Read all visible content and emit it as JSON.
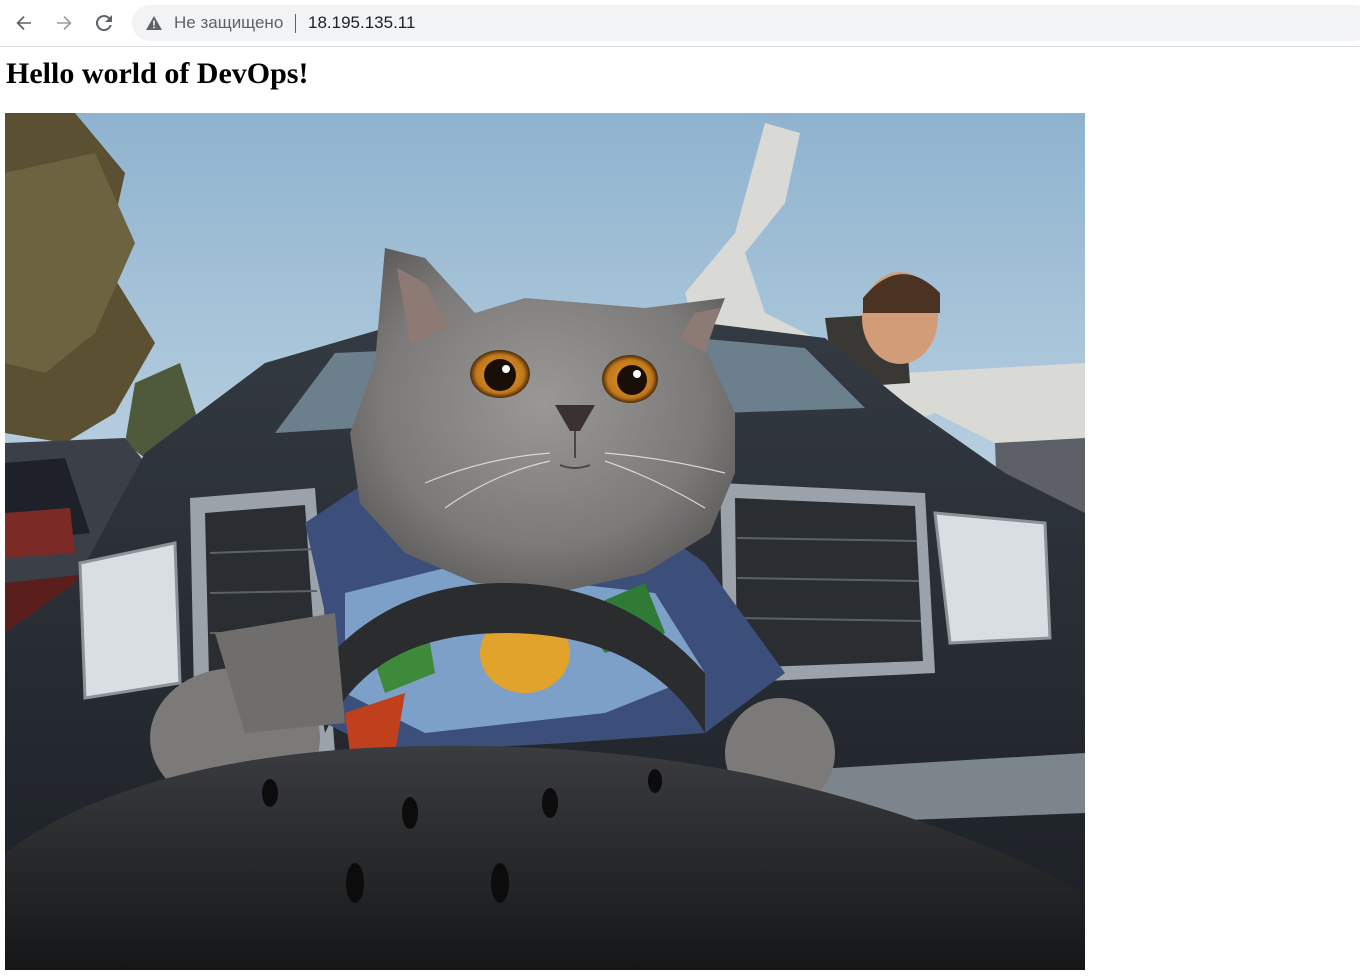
{
  "browser": {
    "security_label": "Не защищено",
    "url": "18.195.135.11"
  },
  "page": {
    "heading": "Hello world of DevOps!"
  },
  "icons": {
    "back": "arrow-left-icon",
    "forward": "arrow-right-icon",
    "reload": "reload-icon",
    "security": "warning-triangle-icon"
  },
  "colors": {
    "toolbar_bg": "#ffffff",
    "omnibox_bg": "#f1f3f4",
    "muted_text": "#5f6368",
    "url_text": "#202124",
    "forward_disabled": "#c4c7c5"
  }
}
